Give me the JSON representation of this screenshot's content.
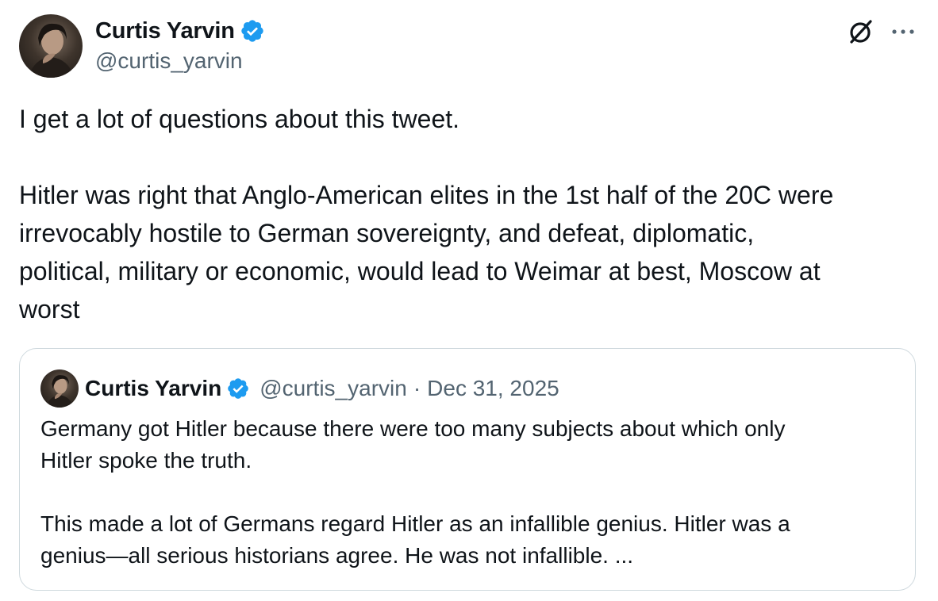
{
  "author": {
    "display_name": "Curtis Yarvin",
    "handle": "@curtis_yarvin",
    "verified": true,
    "avatar_icon": "profile-photo"
  },
  "actions": {
    "grok_icon": "grok-icon",
    "more_icon": "more-options-icon"
  },
  "tweet": {
    "text": "I get a lot of questions about this tweet.\n\nHitler was right that Anglo-American elites in the 1st half of the 20C were\nirrevocably hostile to German sovereignty, and defeat, diplomatic,\npolitical, military or economic, would lead to Weimar at best, Moscow at\nworst"
  },
  "quoted_tweet": {
    "display_name": "Curtis Yarvin",
    "handle": "@curtis_yarvin",
    "separator": "·",
    "date": "Dec 31, 2025",
    "verified": true,
    "text": "Germany got Hitler because there were too many subjects about which only\nHitler spoke the truth.\n\nThis made a lot of Germans regard Hitler as an infallible genius. Hitler was a\ngenius—all serious historians agree. He was not infallible. ..."
  },
  "colors": {
    "text_primary": "#0f1419",
    "text_secondary": "#536471",
    "verified_blue": "#1d9bf0",
    "border": "#cfd9de"
  }
}
